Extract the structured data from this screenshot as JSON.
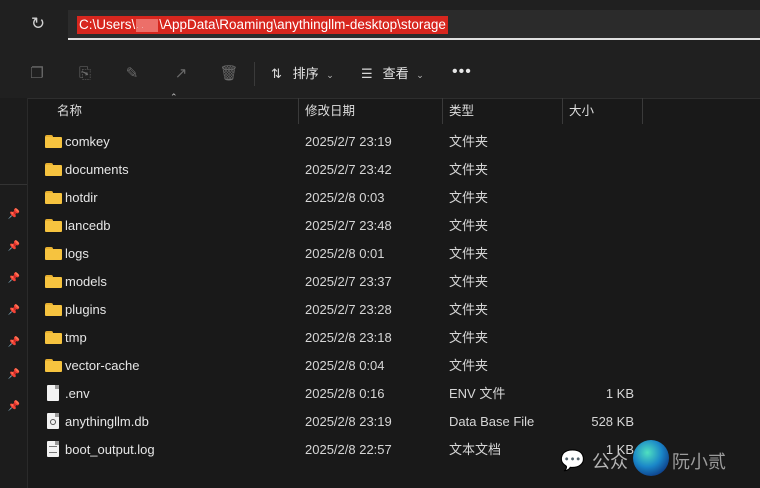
{
  "address": {
    "part1": "C:\\Users\\",
    "redacted_dots": ". .",
    "part2": "\\AppData\\Roaming\\anythingllm-desktop\\storage"
  },
  "toolbar": {
    "sort_label": "排序",
    "view_label": "查看",
    "more_label": "•••"
  },
  "columns": {
    "name": "名称",
    "date": "修改日期",
    "type": "类型",
    "size": "大小"
  },
  "rows": [
    {
      "name": "comkey",
      "date": "2025/2/7 23:19",
      "type": "文件夹",
      "size": "",
      "icon": "folder-icon"
    },
    {
      "name": "documents",
      "date": "2025/2/7 23:42",
      "type": "文件夹",
      "size": "",
      "icon": "folder-icon"
    },
    {
      "name": "hotdir",
      "date": "2025/2/8 0:03",
      "type": "文件夹",
      "size": "",
      "icon": "folder-icon"
    },
    {
      "name": "lancedb",
      "date": "2025/2/7 23:48",
      "type": "文件夹",
      "size": "",
      "icon": "folder-icon"
    },
    {
      "name": "logs",
      "date": "2025/2/8 0:01",
      "type": "文件夹",
      "size": "",
      "icon": "folder-icon"
    },
    {
      "name": "models",
      "date": "2025/2/7 23:37",
      "type": "文件夹",
      "size": "",
      "icon": "folder-icon"
    },
    {
      "name": "plugins",
      "date": "2025/2/7 23:28",
      "type": "文件夹",
      "size": "",
      "icon": "folder-icon"
    },
    {
      "name": "tmp",
      "date": "2025/2/8 23:18",
      "type": "文件夹",
      "size": "",
      "icon": "folder-icon"
    },
    {
      "name": "vector-cache",
      "date": "2025/2/8 0:04",
      "type": "文件夹",
      "size": "",
      "icon": "folder-icon"
    },
    {
      "name": ".env",
      "date": "2025/2/8 0:16",
      "type": "ENV 文件",
      "size": "1 KB",
      "icon": "file-icon"
    },
    {
      "name": "anythingllm.db",
      "date": "2025/2/8 23:19",
      "type": "Data Base File",
      "size": "528 KB",
      "icon": "db-file-icon"
    },
    {
      "name": "boot_output.log",
      "date": "2025/2/8 22:57",
      "type": "文本文档",
      "size": "1 KB",
      "icon": "log-file-icon"
    }
  ],
  "watermark": {
    "prefix": "公众",
    "name": "阮小贰"
  }
}
